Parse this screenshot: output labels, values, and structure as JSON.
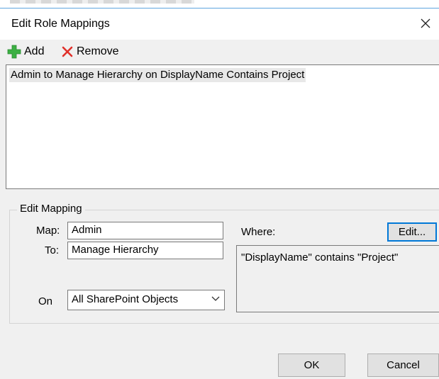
{
  "window": {
    "title": "Edit Role Mappings"
  },
  "toolbar": {
    "add_label": "Add",
    "remove_label": "Remove",
    "add_icon": "green-plus-icon",
    "remove_icon": "red-x-icon",
    "add_color": "#3cb043",
    "remove_color": "#e0302a"
  },
  "mappings": {
    "items": [
      {
        "label": "Admin to Manage Hierarchy on DisplayName Contains Project"
      }
    ]
  },
  "edit_mapping": {
    "legend": "Edit Mapping",
    "map_label": "Map:",
    "map_value": "Admin",
    "to_label": "To:",
    "to_value": "Manage Hierarchy",
    "on_label": "On",
    "on_value": "All SharePoint Objects",
    "where_label": "Where:",
    "edit_label": "Edit...",
    "where_text": "\"DisplayName\" contains \"Project\""
  },
  "footer": {
    "ok_label": "OK",
    "cancel_label": "Cancel"
  },
  "colors": {
    "focus": "#0078d7",
    "dialog_bg": "#f0f0f0"
  }
}
